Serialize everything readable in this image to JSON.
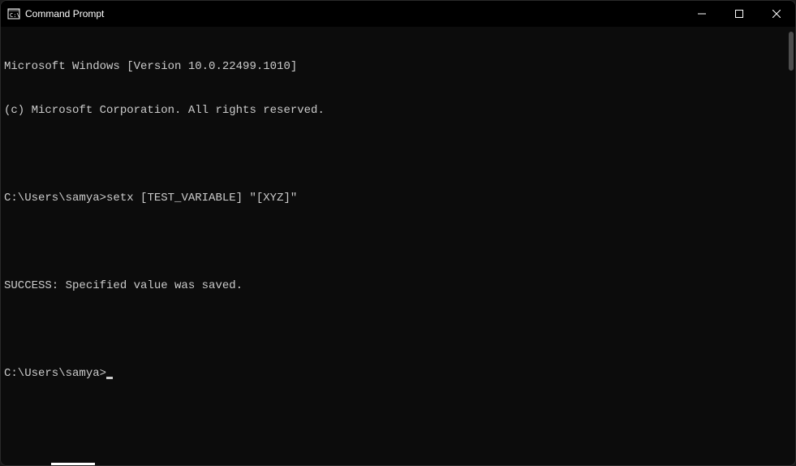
{
  "window": {
    "title": "Command Prompt"
  },
  "terminal": {
    "line1": "Microsoft Windows [Version 10.0.22499.1010]",
    "line2": "(c) Microsoft Corporation. All rights reserved.",
    "prompt1": "C:\\Users\\samya>",
    "command1": "setx [TEST_VARIABLE] \"[XYZ]\"",
    "result": "SUCCESS: Specified value was saved.",
    "prompt2": "C:\\Users\\samya>"
  }
}
